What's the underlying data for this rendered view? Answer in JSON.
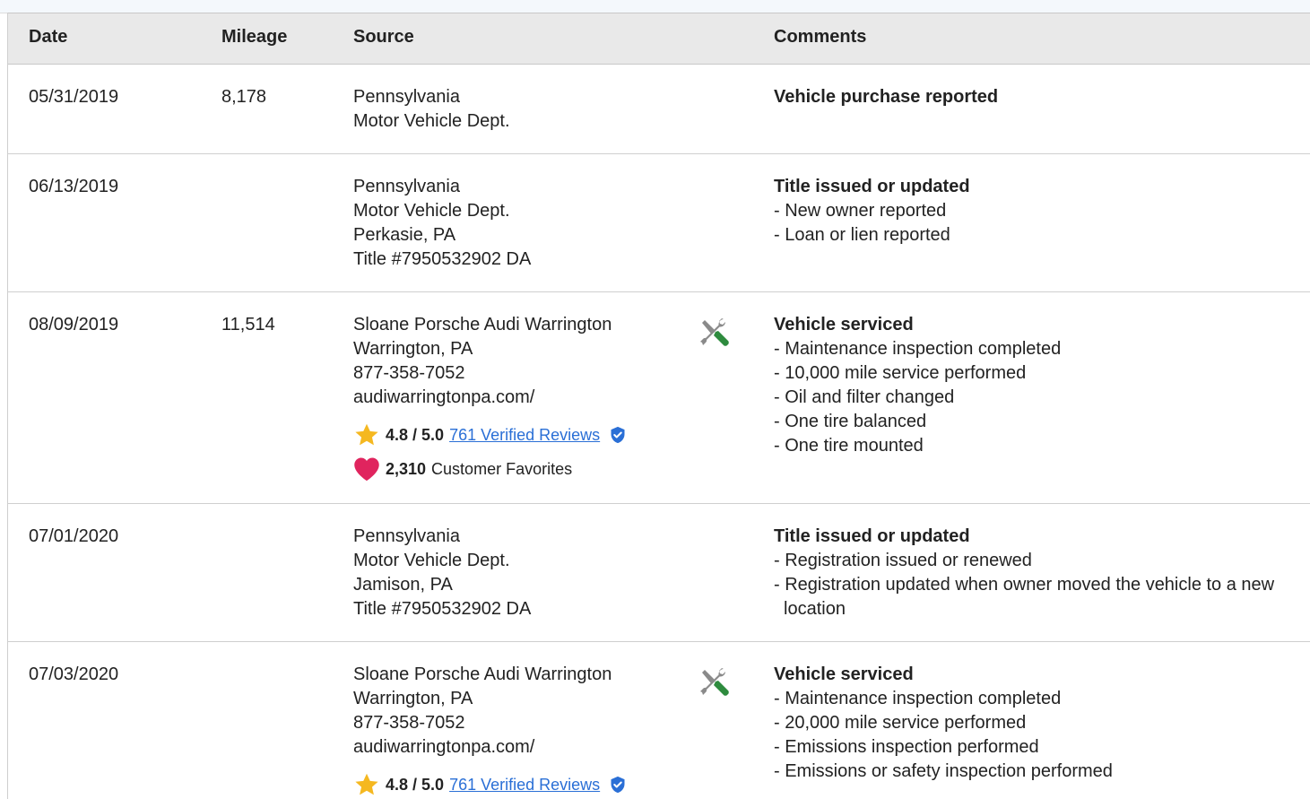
{
  "header": {
    "date": "Date",
    "mileage": "Mileage",
    "source": "Source",
    "comments": "Comments"
  },
  "rows": [
    {
      "date": "05/31/2019",
      "mileage": "8,178",
      "source": [
        "Pennsylvania",
        "Motor Vehicle Dept."
      ],
      "comment_title": "Vehicle purchase reported",
      "comment_items": []
    },
    {
      "date": "06/13/2019",
      "mileage": "",
      "source": [
        "Pennsylvania",
        "Motor Vehicle Dept.",
        "Perkasie, PA",
        "Title #7950532902 DA"
      ],
      "comment_title": "Title issued or updated",
      "comment_items": [
        "- New owner reported",
        "- Loan or lien reported"
      ]
    },
    {
      "date": "08/09/2019",
      "mileage": "11,514",
      "source": [
        "Sloane Porsche Audi Warrington",
        "Warrington, PA",
        "877-358-7052",
        "audiwarringtonpa.com/"
      ],
      "rating": "4.8 / 5.0",
      "reviews_link": "761 Verified Reviews",
      "favorites_count": "2,310",
      "favorites_label": "Customer Favorites",
      "comment_title": "Vehicle serviced",
      "comment_items": [
        "- Maintenance inspection completed",
        "- 10,000 mile service performed",
        "- Oil and filter changed",
        "- One tire balanced",
        "- One tire mounted"
      ]
    },
    {
      "date": "07/01/2020",
      "mileage": "",
      "source": [
        "Pennsylvania",
        "Motor Vehicle Dept.",
        "Jamison, PA",
        "Title #7950532902 DA"
      ],
      "comment_title": "Title issued or updated",
      "comment_items": [
        "- Registration issued or renewed",
        "- Registration updated when owner moved the vehicle to a new location"
      ]
    },
    {
      "date": "07/03/2020",
      "mileage": "",
      "source": [
        "Sloane Porsche Audi Warrington",
        "Warrington, PA",
        "877-358-7052",
        "audiwarringtonpa.com/"
      ],
      "rating": "4.8 / 5.0",
      "reviews_link": "761 Verified Reviews",
      "comment_title": "Vehicle serviced",
      "comment_items": [
        "- Maintenance inspection completed",
        "- 20,000 mile service performed",
        "- Emissions inspection performed",
        "- Emissions or safety inspection performed"
      ]
    }
  ],
  "icons": {
    "service": "wrench-screwdriver-icon",
    "rating": "star-icon",
    "verified": "verified-shield-icon",
    "favorites": "heart-icon"
  },
  "colors": {
    "link": "#2a6fd6",
    "star": "#f5b820",
    "heart": "#e0245e",
    "tool_green": "#2e8b3e",
    "verified": "#2a6fd6"
  }
}
